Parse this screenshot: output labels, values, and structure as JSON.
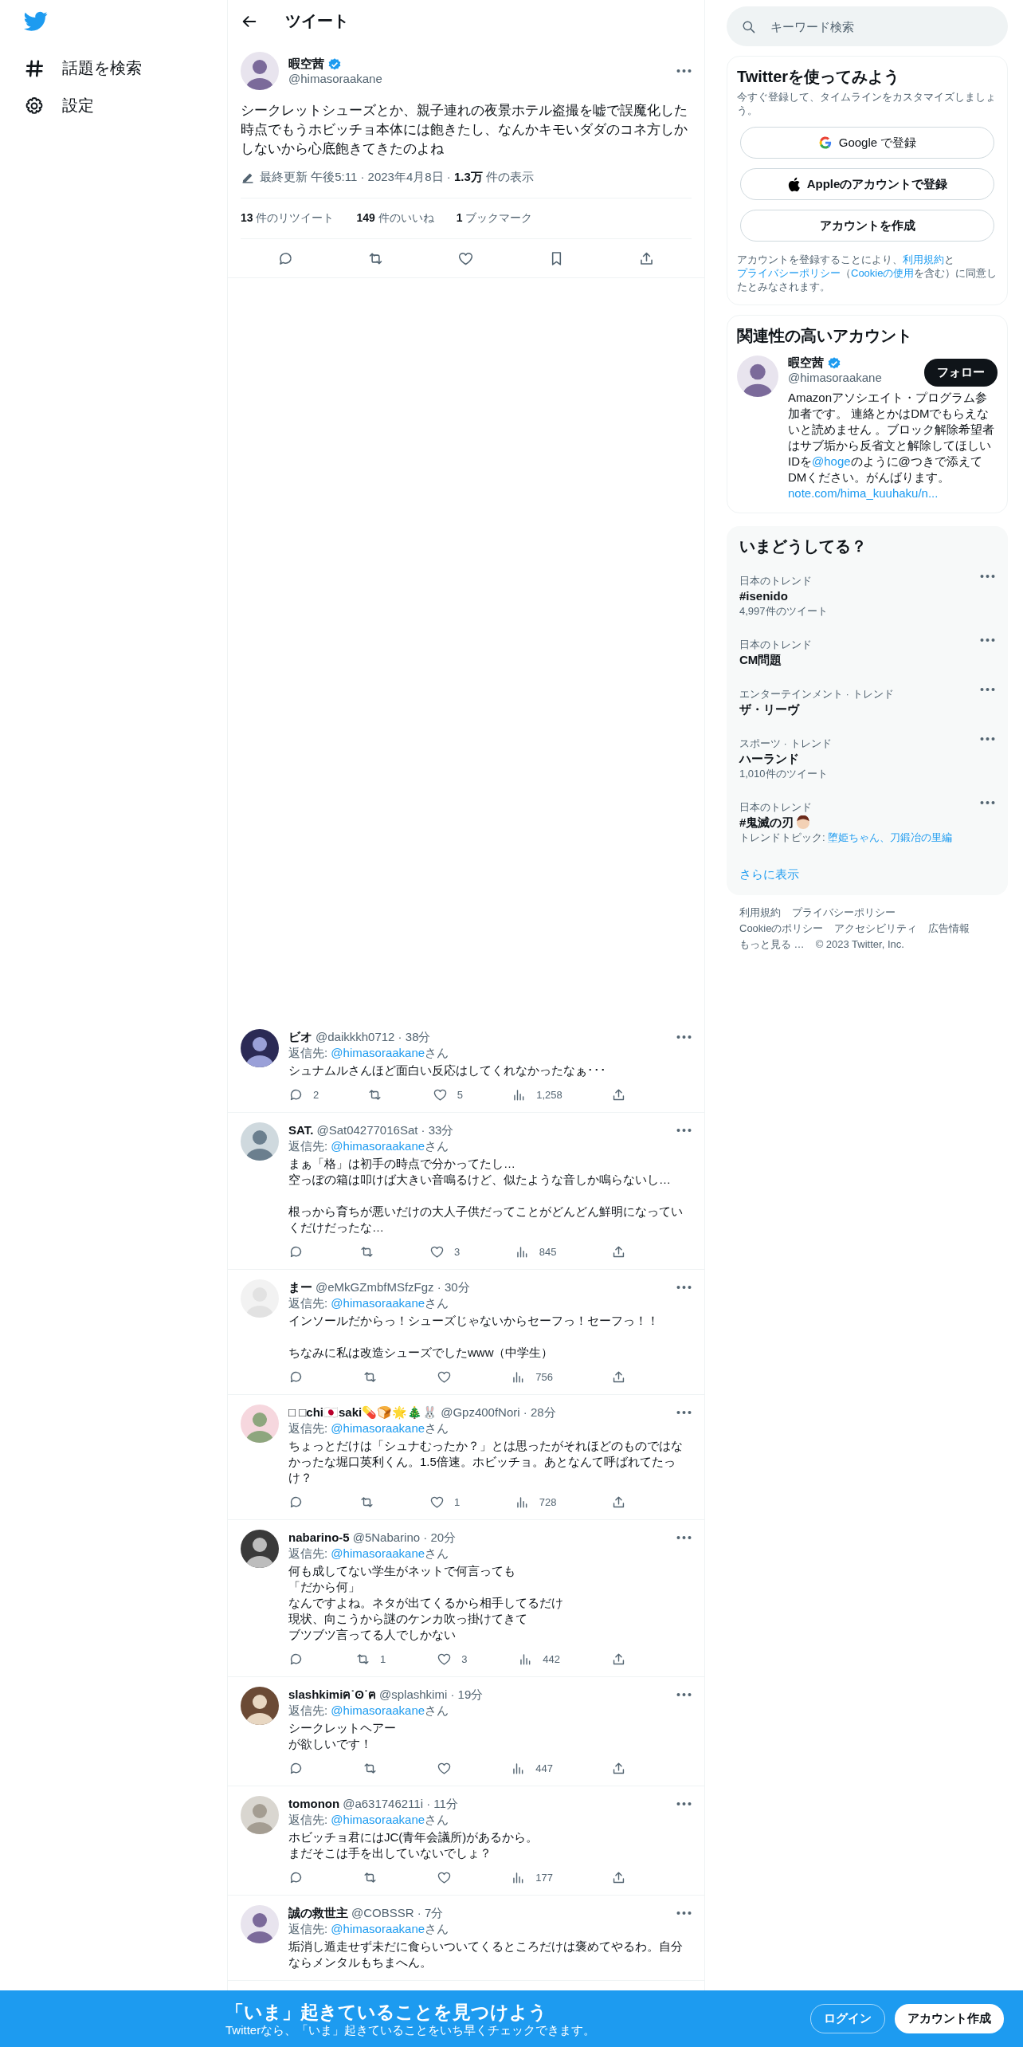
{
  "nav": {
    "items": [
      {
        "kind": "hash",
        "label": "話題を検索"
      },
      {
        "kind": "gear",
        "label": "設定"
      }
    ]
  },
  "header": {
    "title": "ツイート"
  },
  "tweet": {
    "name": "暇空茜",
    "verified": true,
    "handle": "@himasoraakane",
    "text": "シークレットシューズとか、親子連れの夜景ホテル盗撮を嘘で誤魔化した時点でもうホビッチョ本体には飽きたし、なんかキモいダダのコネ方しかしないから心底飽きてきたのよね",
    "meta": "最終更新 午後5:11 · 2023年4月8日 · **1.3万** 件の表示",
    "stats": [
      "**13** 件のリツイート",
      "**149** 件のいいね",
      "**1** ブックマーク"
    ]
  },
  "replies": [
    {
      "name": "ビオ",
      "meta": "@daikkkh0712 · 38分",
      "reply_to": {
        "label": "返信先:",
        "handle": "@himasoraakane",
        "suffix": "さん"
      },
      "paragraphs": [
        [
          "シュナムルさんほど面白い反応はしてくれなかったなぁ･･･"
        ]
      ],
      "counts": {
        "reply": "2",
        "like": "5",
        "views": "1,258"
      }
    },
    {
      "name": "SAT.",
      "meta": "@Sat04277016Sat · 33分",
      "reply_to": {
        "label": "返信先:",
        "handle": "@himasoraakane",
        "suffix": "さん"
      },
      "paragraphs": [
        [
          "まぁ「格」は初手の時点で分かってたし…",
          "空っぽの箱は叩けば大きい音鳴るけど、似たような音しか鳴らないし…"
        ],
        [
          "根っから育ちが悪いだけの大人子供だってことがどんどん鮮明になっていくだけだったな…"
        ]
      ],
      "counts": {
        "like": "3",
        "views": "845"
      }
    },
    {
      "name": "まー",
      "meta": "@eMkGZmbfMSfzFgz · 30分",
      "reply_to": {
        "label": "返信先:",
        "handle": "@himasoraakane",
        "suffix": "さん"
      },
      "paragraphs": [
        [
          "インソールだからっ！シューズじゃないからセーフっ！セーフっ！！"
        ],
        [
          "ちなみに私は改造シューズでしたwww（中学生）"
        ]
      ],
      "counts": {
        "views": "756"
      }
    },
    {
      "name": "□ □chi🇯🇵saki💊🍞🌟🎄🐰",
      "meta": "@Gpz400fNori · 28分",
      "reply_to": {
        "label": "返信先:",
        "handle": "@himasoraakane",
        "suffix": "さん"
      },
      "paragraphs": [
        [
          "ちょっとだけは「シュナむったか？」とは思ったがそれほどのものではなかったな堀口英利くん。1.5倍速。ホビッチョ。あとなんて呼ばれてたっけ？"
        ]
      ],
      "counts": {
        "like": "1",
        "views": "728"
      }
    },
    {
      "name": "nabarino-5",
      "meta": "@5Nabarino · 20分",
      "reply_to": {
        "label": "返信先:",
        "handle": "@himasoraakane",
        "suffix": "さん"
      },
      "paragraphs": [
        [
          "何も成してない学生がネットで何言っても",
          "「だから何」",
          "なんですよね。ネタが出てくるから相手してるだけ",
          "現状、向こうから謎のケンカ吹っ掛けてきて",
          "ブツブツ言ってる人でしかない"
        ]
      ],
      "counts": {
        "retweet": "1",
        "like": "3",
        "views": "442"
      }
    },
    {
      "name": "slashkimiฅ˙ʘ˙ฅ",
      "meta": "@splashkimi · 19分",
      "reply_to": {
        "label": "返信先:",
        "handle": "@himasoraakane",
        "suffix": "さん"
      },
      "paragraphs": [
        [
          "シークレットヘアー",
          "が欲しいです！"
        ]
      ],
      "counts": {
        "views": "447"
      }
    },
    {
      "name": "tomonon",
      "meta": "@a631746211i · 11分",
      "reply_to": {
        "label": "返信先:",
        "handle": "@himasoraakane",
        "suffix": "さん"
      },
      "paragraphs": [
        [
          "ホビッチョ君にはJC(青年会議所)があるから。",
          "まだそこは手を出していないでしょ？"
        ]
      ],
      "counts": {
        "views": "177"
      }
    },
    {
      "name": "誠の救世主",
      "meta": "@COBSSR · 7分",
      "reply_to": {
        "label": "返信先:",
        "handle": "@himasoraakane",
        "suffix": "さん"
      },
      "paragraphs": [
        [
          "垢消し遁走せず未だに食らいついてくるところだけは褒めてやるわ。自分ならメンタルもちまへん。"
        ]
      ]
    }
  ],
  "search": {
    "placeholder": "キーワード検索"
  },
  "signup": {
    "title": "Twitterを使ってみよう",
    "subtitle": "今すぐ登録して、タイムラインをカスタマイズしましょう。",
    "buttons": [
      {
        "kind": "google",
        "label": "Google で登録"
      },
      {
        "kind": "apple",
        "label": "Appleのアカウントで登録"
      },
      {
        "kind": "plain",
        "label": "アカウントを作成"
      }
    ],
    "terms": [
      {
        "kind": "text",
        "text": "アカウントを登録することにより、"
      },
      {
        "kind": "link",
        "text": "利用規約"
      },
      {
        "kind": "text",
        "text": "と"
      },
      {
        "kind": "link",
        "text": "プライバシーポリシー"
      },
      {
        "kind": "text",
        "text": "（"
      },
      {
        "kind": "link",
        "text": "Cookieの使用"
      },
      {
        "kind": "text",
        "text": "を含む）に同意したとみなされます。"
      }
    ]
  },
  "who": {
    "title": "関連性の高いアカウント",
    "accounts": [
      {
        "name": "暇空茜",
        "verified": true,
        "handle": "@himasoraakane",
        "button": "フォロー",
        "bio": [
          {
            "kind": "text",
            "text": "Amazonアソシエイト・プログラム参加者です。 連絡とかはDMでもらえないと読めません 。ブロック解除希望者はサブ垢から反省文と解除してほしいIDを"
          },
          {
            "kind": "link",
            "text": "@hoge"
          },
          {
            "kind": "text",
            "text": "のように@つきで添えてDMください。がんばります。"
          },
          {
            "kind": "link",
            "text": "note.com/hima_kuuhaku/n..."
          }
        ]
      }
    ]
  },
  "trends": {
    "title": "いまどうしてる？",
    "items": [
      {
        "context": "日本のトレンド",
        "name": "#isenido",
        "count": "4,997件のツイート",
        "hashflag": false
      },
      {
        "context": "日本のトレンド",
        "name": "CM問題",
        "hashflag": false
      },
      {
        "context": "エンターテインメント · トレンド",
        "name": "ザ・リーヴ",
        "hashflag": false
      },
      {
        "context": "スポーツ · トレンド",
        "name": "ハーランド",
        "count": "1,010件のツイート",
        "hashflag": false
      },
      {
        "context": "日本のトレンド",
        "name": "#鬼滅の刃",
        "hashflag": true,
        "topic_label": "トレンドトピック:",
        "topic_links": "堕姫ちゃん、刀鍛冶の里編"
      }
    ],
    "more": "さらに表示"
  },
  "footer": {
    "links": [
      "利用規約",
      "プライバシーポリシー",
      "Cookieのポリシー",
      "アクセシビリティ",
      "広告情報",
      "もっと見る …"
    ],
    "copyright": "© 2023 Twitter, Inc."
  },
  "bottom_bar": {
    "title": "「いま」起きていることを見つけよう",
    "subtitle": "Twitterなら、「いま」起きていることをいち早くチェックできます。",
    "buttons": [
      {
        "kind": "outline",
        "label": "ログイン"
      },
      {
        "kind": "filled",
        "label": "アカウント作成"
      }
    ]
  }
}
